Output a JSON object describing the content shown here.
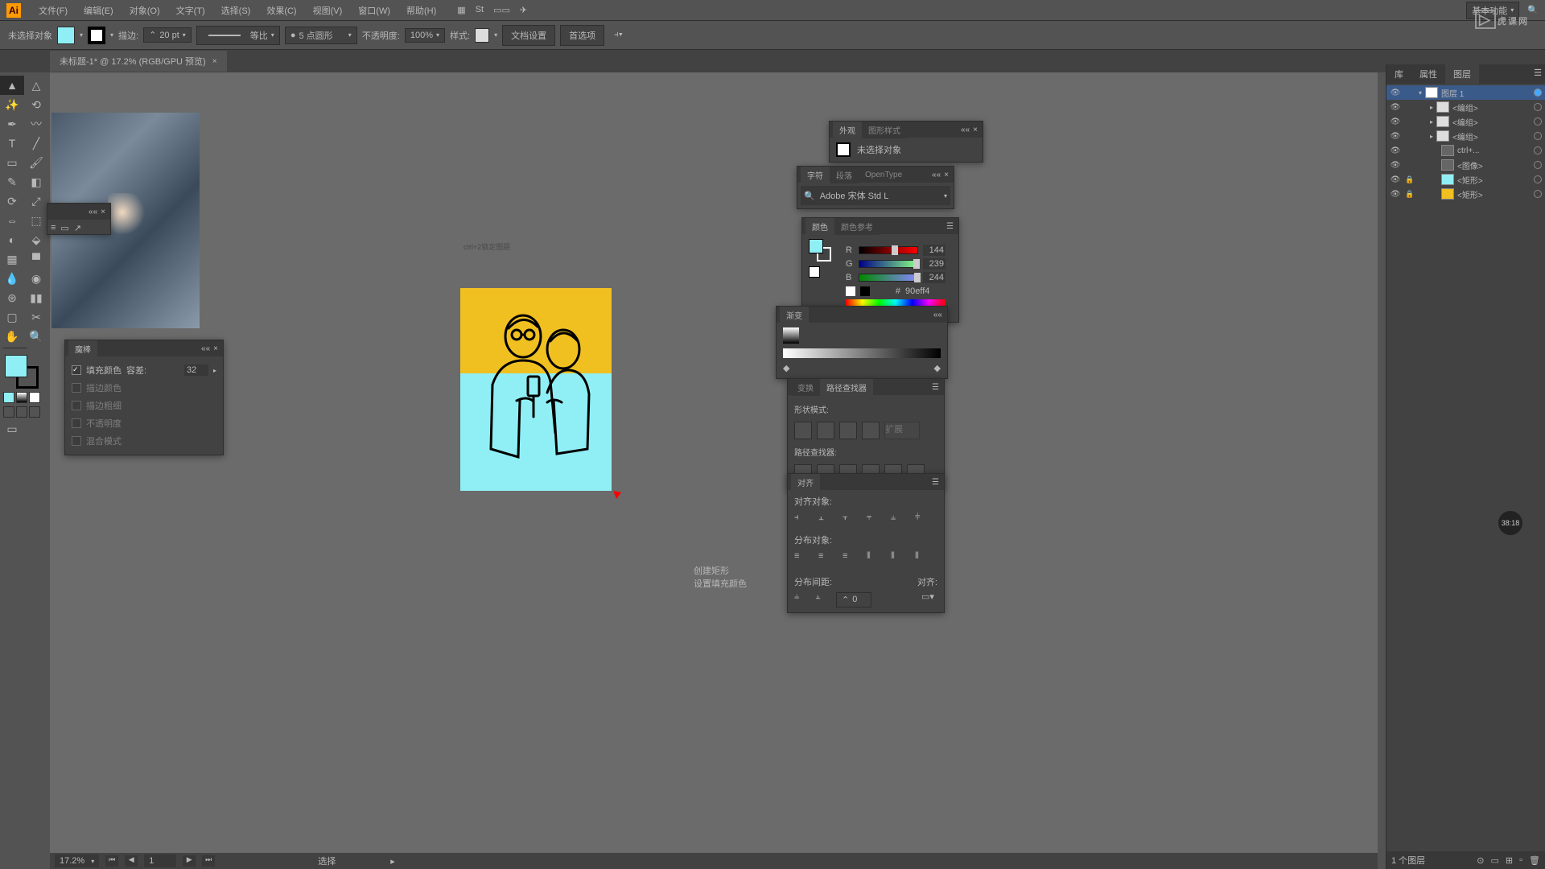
{
  "app": {
    "logo": "Ai"
  },
  "menu": {
    "file": "文件(F)",
    "edit": "编辑(E)",
    "object": "对象(O)",
    "type": "文字(T)",
    "select": "选择(S)",
    "effect": "效果(C)",
    "view": "视图(V)",
    "window": "窗口(W)",
    "help": "帮助(H)"
  },
  "menubar_right": {
    "workspace": "基本功能",
    "search_placeholder": "搜索"
  },
  "control": {
    "no_sel": "未选择对象",
    "stroke_lbl": "描边:",
    "stroke_w": "20 pt",
    "stroke_style": "等比",
    "brush": "5 点圆形",
    "opacity_lbl": "不透明度:",
    "opacity": "100%",
    "style_lbl": "样式:",
    "doc_setup": "文档设置",
    "prefs": "首选项"
  },
  "tab": {
    "title": "未标题-1* @ 17.2% (RGB/GPU 预览)"
  },
  "status": {
    "zoom": "17.2%",
    "page": "1",
    "sel": "选择"
  },
  "canvas": {
    "hint": "ctrl+2锁定图层",
    "anno1": "创建矩形",
    "anno2": "设置填充颜色"
  },
  "panels": {
    "magic": {
      "title": "魔棒",
      "fill": "填充颜色",
      "tol_lbl": "容差:",
      "tol": "32",
      "stroke": "描边颜色",
      "strokew": "描边粗细",
      "opacity": "不透明度",
      "blend": "混合模式"
    },
    "appearance": {
      "tab1": "外观",
      "tab2": "图形样式",
      "none": "未选择对象"
    },
    "char": {
      "tab1": "字符",
      "tab2": "段落",
      "tab3": "OpenType",
      "font": "Adobe 宋体 Std L"
    },
    "color": {
      "tab1": "颜色",
      "tab2": "颜色参考",
      "r": "R",
      "g": "G",
      "b": "B",
      "rv": "144",
      "gv": "239",
      "bv": "244",
      "hex": "90eff4"
    },
    "grad": {
      "tab": "渐变"
    },
    "transform": {
      "tab": "变换"
    },
    "path": {
      "tab": "路径查找器",
      "shape": "形状模式:",
      "pf": "路径查找器:",
      "expand": "扩展"
    },
    "align": {
      "tab": "对齐",
      "ao": "对齐对象:",
      "do": "分布对象:",
      "ds": "分布间距:",
      "at": "对齐:",
      "val": "0"
    }
  },
  "layers": {
    "tab_lib": "库",
    "tab_props": "属性",
    "tab_layers": "图层",
    "items": [
      {
        "name": "图层 1",
        "indent": 0,
        "sel": true
      },
      {
        "name": "<编组>",
        "indent": 1
      },
      {
        "name": "<编组>",
        "indent": 1
      },
      {
        "name": "<编组>",
        "indent": 1
      },
      {
        "name": "ctrl+...",
        "indent": 1
      },
      {
        "name": "<图像>",
        "indent": 1
      },
      {
        "name": "<矩形>",
        "indent": 1,
        "lock": true
      },
      {
        "name": "<矩形>",
        "indent": 1,
        "lock": true
      }
    ],
    "foot": "1 个图层"
  },
  "watermark": "虎课网",
  "timer": "38:18",
  "colors": {
    "fill": "#90eff4",
    "artYellow": "#f0c020"
  }
}
